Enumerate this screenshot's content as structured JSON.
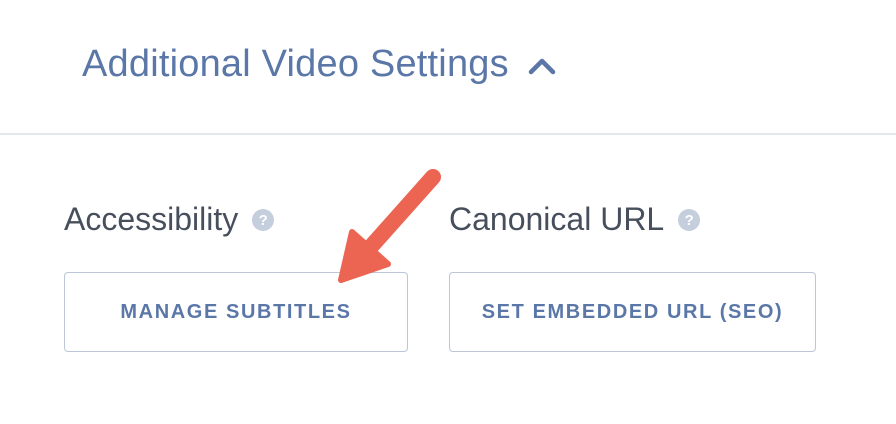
{
  "section": {
    "title": "Additional Video Settings",
    "toggle_icon": "chevron-up-icon"
  },
  "fields": {
    "accessibility": {
      "label": "Accessibility",
      "help_glyph": "?",
      "button_label": "MANAGE SUBTITLES"
    },
    "canonical_url": {
      "label": "Canonical URL",
      "help_glyph": "?",
      "button_label": "SET EMBEDDED URL (SEO)"
    }
  },
  "annotation": {
    "icon": "arrow-icon",
    "color": "#ec6452"
  },
  "colors": {
    "accent": "#5a77a8",
    "label": "#474f5c",
    "border": "#bcc6d6",
    "help_icon_bg": "#c5cedd",
    "divider": "#e4e8ee"
  }
}
